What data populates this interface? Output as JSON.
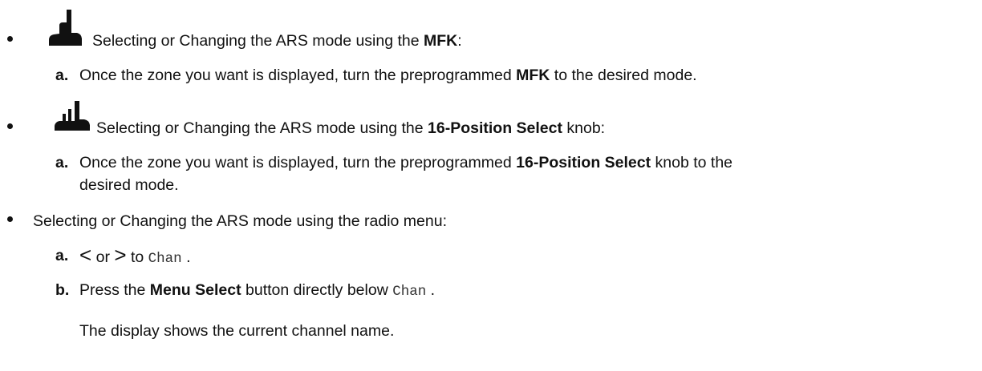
{
  "bullets": [
    {
      "icon": "mfk-knob-icon",
      "text_before": "Selecting or Changing the ARS mode using the ",
      "bold": "MFK",
      "text_after": ":",
      "steps": [
        {
          "letter": "a.",
          "text_before": "Once the zone you want is displayed, turn the preprogrammed ",
          "bold": "MFK",
          "text_after": " to the desired mode."
        }
      ]
    },
    {
      "icon": "16-position-select-knob-icon",
      "text_before": "Selecting or Changing the ARS mode using the ",
      "bold": "16-Position Select",
      "text_after": " knob:",
      "steps": [
        {
          "letter": "a.",
          "text_before": "Once the zone you want is displayed, turn the preprogrammed ",
          "bold": "16-Position Select",
          "text_after": " knob to the",
          "text_line2": "desired mode."
        }
      ]
    },
    {
      "text": "Selecting or Changing the ARS mode using the radio menu:",
      "steps": [
        {
          "letter": "a.",
          "left_glyph": "<",
          "or_text": " or ",
          "right_glyph": ">",
          "to_text": " to ",
          "mono": "Chan",
          "text_after": " ."
        },
        {
          "letter": "b.",
          "text_before": "Press the ",
          "bold": "Menu Select",
          "text_after": " button directly below ",
          "mono": "Chan",
          "text_after2": " .",
          "result": "The display shows the current channel name."
        }
      ]
    }
  ]
}
